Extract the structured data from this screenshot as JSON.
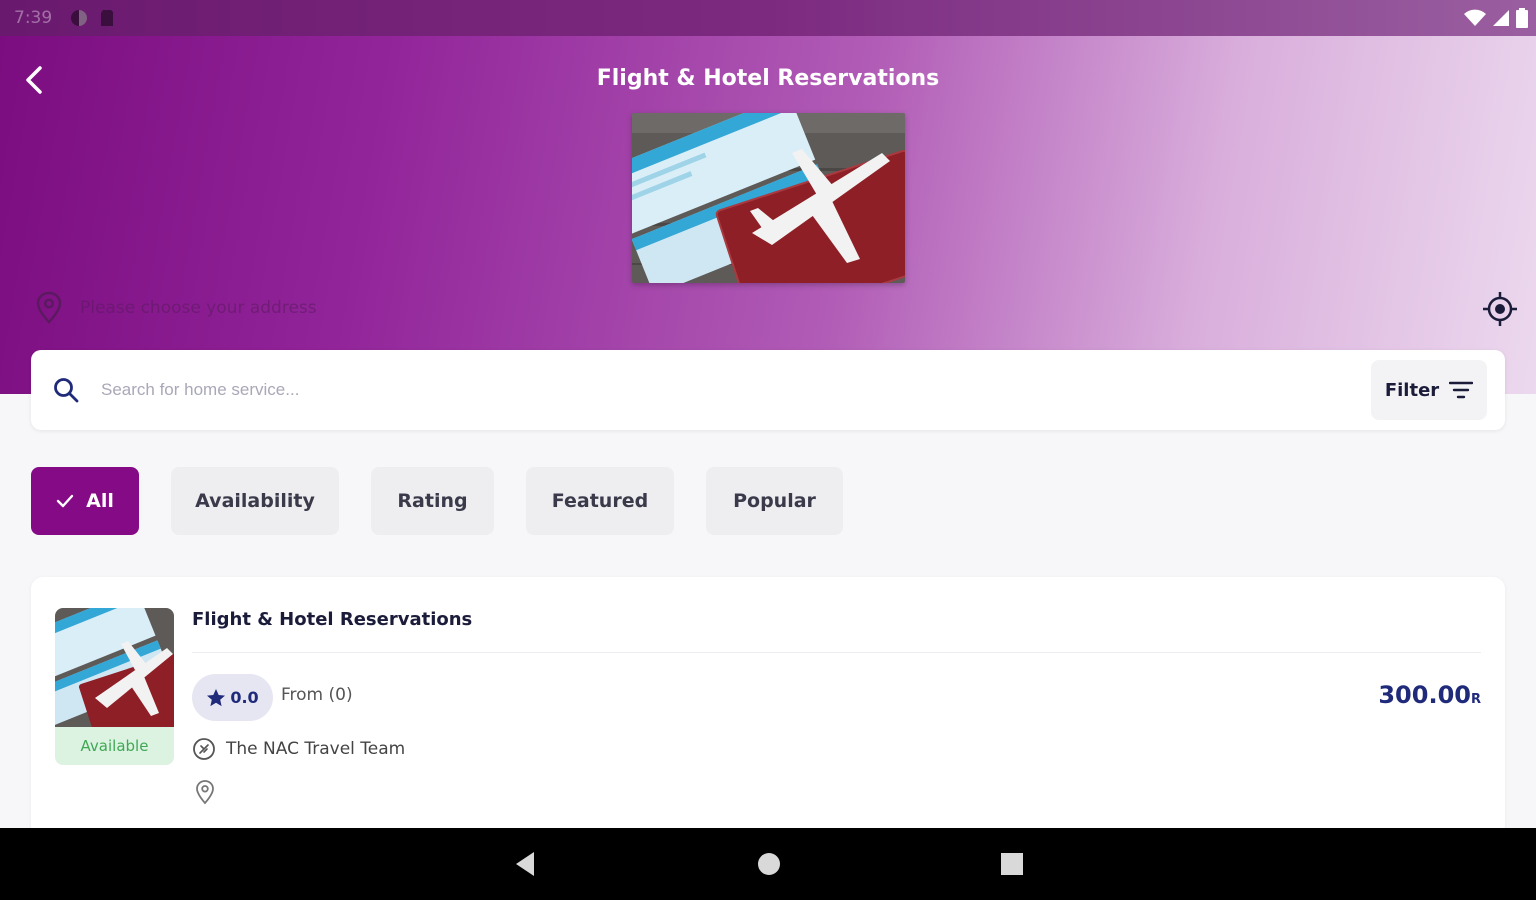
{
  "status_bar": {
    "time": "7:39"
  },
  "header": {
    "title": "Flight & Hotel Reservations",
    "address_placeholder": "Please choose your address"
  },
  "search": {
    "placeholder": "Search for home service...",
    "filter_label": "Filter"
  },
  "chips": [
    {
      "label": "All",
      "active": true
    },
    {
      "label": "Availability",
      "active": false
    },
    {
      "label": "Rating",
      "active": false
    },
    {
      "label": "Featured",
      "active": false
    },
    {
      "label": "Popular",
      "active": false
    }
  ],
  "service_card": {
    "title": "Flight & Hotel Reservations",
    "availability": "Available",
    "rating": "0.0",
    "rating_from": "From (0)",
    "price": "300.00",
    "currency": "R",
    "provider": "The NAC Travel Team"
  },
  "colors": {
    "brand": "#850b86",
    "price": "#1f2a7a",
    "available_bg": "#ddf3e1",
    "available_text": "#3fa855"
  }
}
